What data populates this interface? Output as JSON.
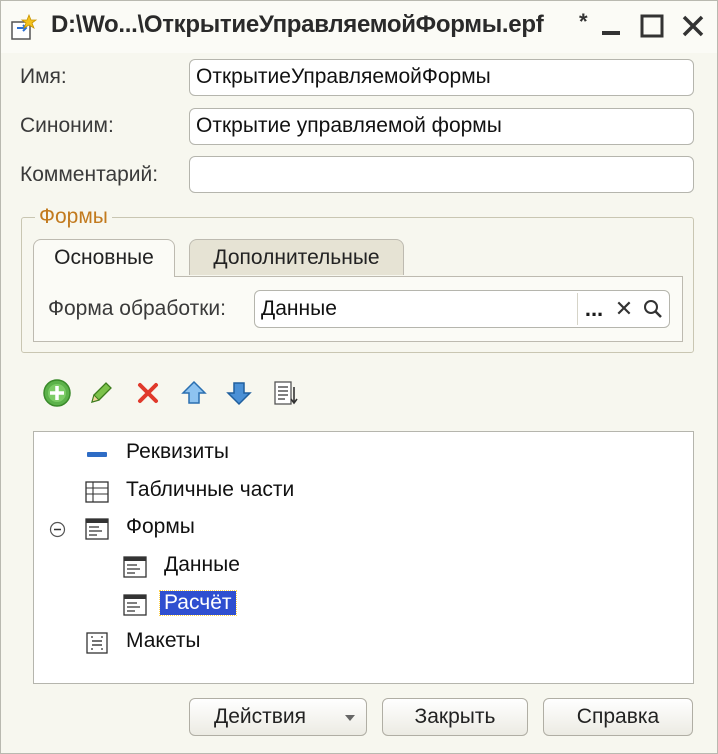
{
  "window": {
    "title": "D:\\Wo...\\ОткрытиеУправляемойФормы.epf",
    "modified_marker": "*"
  },
  "fields": {
    "name_label": "Имя:",
    "name_value": "ОткрытиеУправляемойФормы",
    "synonym_label": "Синоним:",
    "synonym_value": "Открытие управляемой формы",
    "comment_label": "Комментарий:",
    "comment_value": ""
  },
  "forms_group": {
    "title": "Формы",
    "tabs": [
      {
        "label": "Основные",
        "active": true
      },
      {
        "label": "Дополнительные",
        "active": false
      }
    ],
    "processing_form_label": "Форма обработки:",
    "processing_form_value": "Данные",
    "select_buttons": {
      "choose": "...",
      "clear": "✕"
    }
  },
  "toolbar": {
    "items": [
      "add-icon",
      "edit-icon",
      "delete-icon",
      "move-up-icon",
      "move-down-icon",
      "sort-list-icon"
    ]
  },
  "tree": {
    "items": [
      {
        "label": "Реквизиты",
        "icon": "attribute-icon",
        "level": 0
      },
      {
        "label": "Табличные части",
        "icon": "table-icon",
        "level": 0
      },
      {
        "label": "Формы",
        "icon": "form-icon",
        "level": 0,
        "expanded": true
      },
      {
        "label": "Данные",
        "icon": "form-icon",
        "level": 1
      },
      {
        "label": "Расчёт",
        "icon": "form-icon",
        "level": 1,
        "selected": true
      },
      {
        "label": "Макеты",
        "icon": "template-icon",
        "level": 0
      }
    ]
  },
  "buttons": {
    "actions": "Действия",
    "close": "Закрыть",
    "help": "Справка"
  },
  "colors": {
    "window_bg": "#f7f7ef",
    "group_title": "#c27a1e",
    "selection": "#2f4fd0"
  }
}
